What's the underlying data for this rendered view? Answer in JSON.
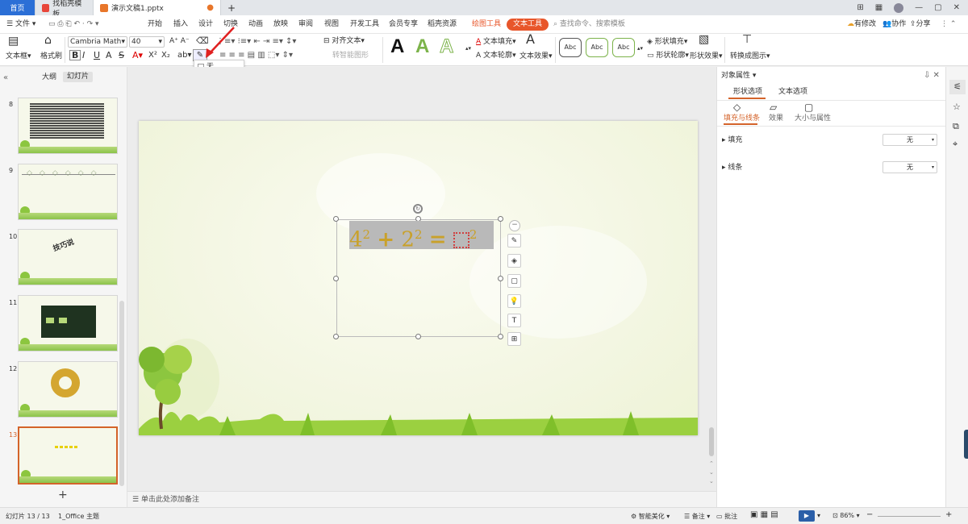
{
  "titlebar": {
    "tabs": [
      {
        "label": "首页"
      },
      {
        "label": "找稻壳模板"
      },
      {
        "label": "演示文稿1.pptx"
      }
    ],
    "new_tab": "+"
  },
  "menu": {
    "file": "文件",
    "items": [
      "开始",
      "插入",
      "设计",
      "切换",
      "动画",
      "放映",
      "审阅",
      "视图",
      "开发工具",
      "会员专享",
      "稻壳资源"
    ],
    "context_tabs": [
      "绘图工具",
      "文本工具"
    ],
    "search_placeholder": "查找命令、搜索模板",
    "right": [
      "有修改",
      "协作",
      "分享"
    ]
  },
  "ribbon": {
    "textbox": "文本框",
    "format_painter": "格式刷",
    "font_name": "Cambria Math",
    "font_size": "40",
    "align_text": "对齐文本",
    "smartart": "转智能图形",
    "text_fill": "文本填充",
    "text_outline": "文本轮廓",
    "text_effect": "文本效果",
    "shape_fill": "形状填充",
    "shape_outline": "形状轮廓",
    "shape_effect": "形状效果",
    "convert": "转换成图示",
    "abc_styles": [
      "Abc",
      "Abc",
      "Abc"
    ],
    "bold": "B",
    "italic": "I",
    "underline": "U",
    "strike": "S"
  },
  "colorpop": {
    "none_label": "无",
    "colors": [
      "#ffff00",
      "#00ff00",
      "#00ffff",
      "#ff00ff",
      "#0000ff",
      "#ff0000",
      "#000080",
      "#008080",
      "#008000",
      "#800080",
      "#800000",
      "#808000",
      "#808080",
      "#c0c0c0",
      "#000000"
    ]
  },
  "leftpanel": {
    "tabs": [
      "大纲",
      "幻灯片"
    ],
    "slides": [
      {
        "num": "8"
      },
      {
        "num": "9"
      },
      {
        "num": "10",
        "text": "技巧说"
      },
      {
        "num": "11"
      },
      {
        "num": "12"
      },
      {
        "num": "13"
      }
    ],
    "add": "+"
  },
  "slide": {
    "equation": {
      "base1": "4",
      "exp1": "2",
      "plus": "+",
      "base2": "2",
      "exp2": "2",
      "equals": "=",
      "exp3": "2"
    }
  },
  "notes": {
    "placeholder": "单击此处添加备注"
  },
  "rightpanel": {
    "title": "对象属性",
    "tabs": [
      "形状选项",
      "文本选项"
    ],
    "subtabs": [
      "填充与线条",
      "效果",
      "大小与属性"
    ],
    "sections": [
      {
        "label": "填充",
        "value": "无"
      },
      {
        "label": "线条",
        "value": "无"
      }
    ]
  },
  "status": {
    "slide_info": "幻灯片 13 / 13",
    "theme": "1_Office 主题",
    "smart": "智能美化",
    "notes": "备注",
    "comments": "批注",
    "zoom": "86%"
  },
  "colors": {
    "accent": "#2b6fd6",
    "context_tab": "#e8562a",
    "eq_text": "#c9a12a",
    "eq_bg": "#b9b9b9",
    "arrow": "#e02020"
  }
}
